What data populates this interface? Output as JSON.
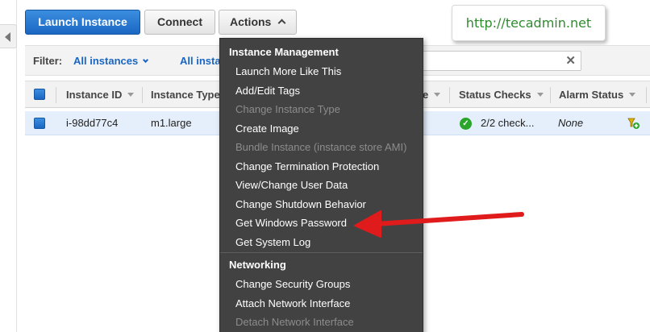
{
  "toolbar": {
    "launch_label": "Launch Instance",
    "connect_label": "Connect",
    "actions_label": "Actions"
  },
  "watermark": "http://tecadmin.net",
  "filter": {
    "label": "Filter:",
    "state_value": "All instances",
    "type_value": "All insta",
    "search_value": ""
  },
  "table": {
    "columns": [
      "Instance ID",
      "Instance Type",
      "e",
      "Status Checks",
      "Alarm Status"
    ],
    "rows": [
      {
        "instance_id": "i-98dd77c4",
        "instance_type": "m1.large",
        "status_checks": "2/2 check...",
        "alarm_status": "None"
      }
    ]
  },
  "menu": {
    "section_instance": "Instance Management",
    "instance_items": [
      {
        "label": "Launch More Like This",
        "enabled": true
      },
      {
        "label": "Add/Edit Tags",
        "enabled": true
      },
      {
        "label": "Change Instance Type",
        "enabled": false
      },
      {
        "label": "Create Image",
        "enabled": true
      },
      {
        "label": "Bundle Instance (instance store AMI)",
        "enabled": false
      },
      {
        "label": "Change Termination Protection",
        "enabled": true
      },
      {
        "label": "View/Change User Data",
        "enabled": true
      },
      {
        "label": "Change Shutdown Behavior",
        "enabled": true
      },
      {
        "label": "Get Windows Password",
        "enabled": true
      },
      {
        "label": "Get System Log",
        "enabled": true
      }
    ],
    "section_networking": "Networking",
    "networking_items": [
      {
        "label": "Change Security Groups",
        "enabled": true
      },
      {
        "label": "Attach Network Interface",
        "enabled": true
      },
      {
        "label": "Detach Network Interface",
        "enabled": false
      }
    ]
  },
  "colors": {
    "primary": "#1b67c2",
    "menu_bg": "#424242",
    "row_selected": "#e4effb",
    "annotation_arrow": "#e01b1b",
    "watermark_text": "#2e8b2e"
  },
  "icons": {
    "status_ok": "check-circle-icon",
    "alarm": "alarm-bell-icon"
  }
}
